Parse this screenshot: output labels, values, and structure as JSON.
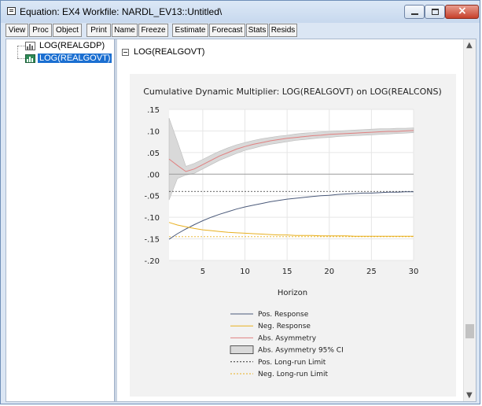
{
  "window": {
    "title": "Equation: EX4   Workfile: NARDL_EV13::Untitled\\"
  },
  "toolbar": {
    "buttons": [
      "View",
      "Proc",
      "Object",
      "Print",
      "Name",
      "Freeze",
      "Estimate",
      "Forecast",
      "Stats",
      "Resids"
    ]
  },
  "tree": {
    "items": [
      {
        "label": "LOG(REALGDP)",
        "selected": false
      },
      {
        "label": "LOG(REALGOVT)",
        "selected": true
      }
    ]
  },
  "graph_node": {
    "label": "LOG(REALGOVT)"
  },
  "colors": {
    "pos_response": "#4b5a7a",
    "neg_response": "#e8b020",
    "abs_asymmetry": "#e08080",
    "ci_band": "#d9d9d9",
    "zero_line": "#888888",
    "selected_bg": "#1b6fd1"
  },
  "chart_data": {
    "type": "line",
    "title": "Cumulative Dynamic Multiplier: LOG(REALGOVT) on LOG(REALCONS)",
    "xlabel": "Horizon",
    "ylabel": "",
    "xlim": [
      1,
      30
    ],
    "ylim": [
      -0.2,
      0.15
    ],
    "x_ticks": [
      5,
      10,
      15,
      20,
      25,
      30
    ],
    "y_ticks": [
      ".15",
      ".10",
      ".05",
      ".00",
      "-.05",
      "-.10",
      "-.15",
      "-.20"
    ],
    "y_tick_values": [
      0.15,
      0.1,
      0.05,
      0.0,
      -0.05,
      -0.1,
      -0.15,
      -0.2
    ],
    "grid": true,
    "legend_position": "bottom",
    "x": [
      1,
      2,
      3,
      4,
      5,
      6,
      7,
      8,
      9,
      10,
      11,
      12,
      13,
      14,
      15,
      16,
      17,
      18,
      19,
      20,
      21,
      22,
      23,
      24,
      25,
      26,
      27,
      28,
      29,
      30
    ],
    "series": [
      {
        "name": "Pos. Response",
        "values": [
          -0.151,
          -0.138,
          -0.127,
          -0.117,
          -0.108,
          -0.1,
          -0.093,
          -0.087,
          -0.081,
          -0.076,
          -0.072,
          -0.068,
          -0.064,
          -0.061,
          -0.058,
          -0.056,
          -0.054,
          -0.052,
          -0.05,
          -0.049,
          -0.047,
          -0.046,
          -0.045,
          -0.044,
          -0.044,
          -0.043,
          -0.042,
          -0.042,
          -0.041,
          -0.041
        ]
      },
      {
        "name": "Neg. Response",
        "values": [
          -0.112,
          -0.118,
          -0.122,
          -0.126,
          -0.129,
          -0.131,
          -0.133,
          -0.135,
          -0.136,
          -0.137,
          -0.138,
          -0.139,
          -0.14,
          -0.141,
          -0.141,
          -0.142,
          -0.142,
          -0.142,
          -0.143,
          -0.143,
          -0.143,
          -0.143,
          -0.144,
          -0.144,
          -0.144,
          -0.144,
          -0.144,
          -0.144,
          -0.144,
          -0.144
        ]
      },
      {
        "name": "Abs. Asymmetry",
        "values": [
          0.035,
          0.02,
          0.006,
          0.012,
          0.022,
          0.032,
          0.042,
          0.05,
          0.058,
          0.064,
          0.069,
          0.073,
          0.077,
          0.08,
          0.083,
          0.085,
          0.087,
          0.089,
          0.09,
          0.092,
          0.093,
          0.094,
          0.095,
          0.096,
          0.097,
          0.098,
          0.099,
          0.099,
          0.1,
          0.101
        ]
      },
      {
        "name": "Abs. Asymmetry 95% CI",
        "lower": [
          -0.06,
          -0.01,
          -0.002,
          0.002,
          0.012,
          0.022,
          0.032,
          0.04,
          0.048,
          0.055,
          0.06,
          0.065,
          0.069,
          0.072,
          0.075,
          0.078,
          0.08,
          0.082,
          0.084,
          0.085,
          0.087,
          0.088,
          0.089,
          0.09,
          0.091,
          0.092,
          0.093,
          0.094,
          0.095,
          0.096
        ],
        "upper": [
          0.13,
          0.075,
          0.018,
          0.025,
          0.034,
          0.044,
          0.053,
          0.061,
          0.068,
          0.073,
          0.078,
          0.082,
          0.085,
          0.088,
          0.09,
          0.093,
          0.095,
          0.096,
          0.098,
          0.099,
          0.1,
          0.101,
          0.102,
          0.103,
          0.104,
          0.105,
          0.105,
          0.106,
          0.106,
          0.107
        ]
      },
      {
        "name": "Pos. Long-run Limit",
        "value": -0.04
      },
      {
        "name": "Neg. Long-run Limit",
        "value": -0.145
      }
    ]
  }
}
